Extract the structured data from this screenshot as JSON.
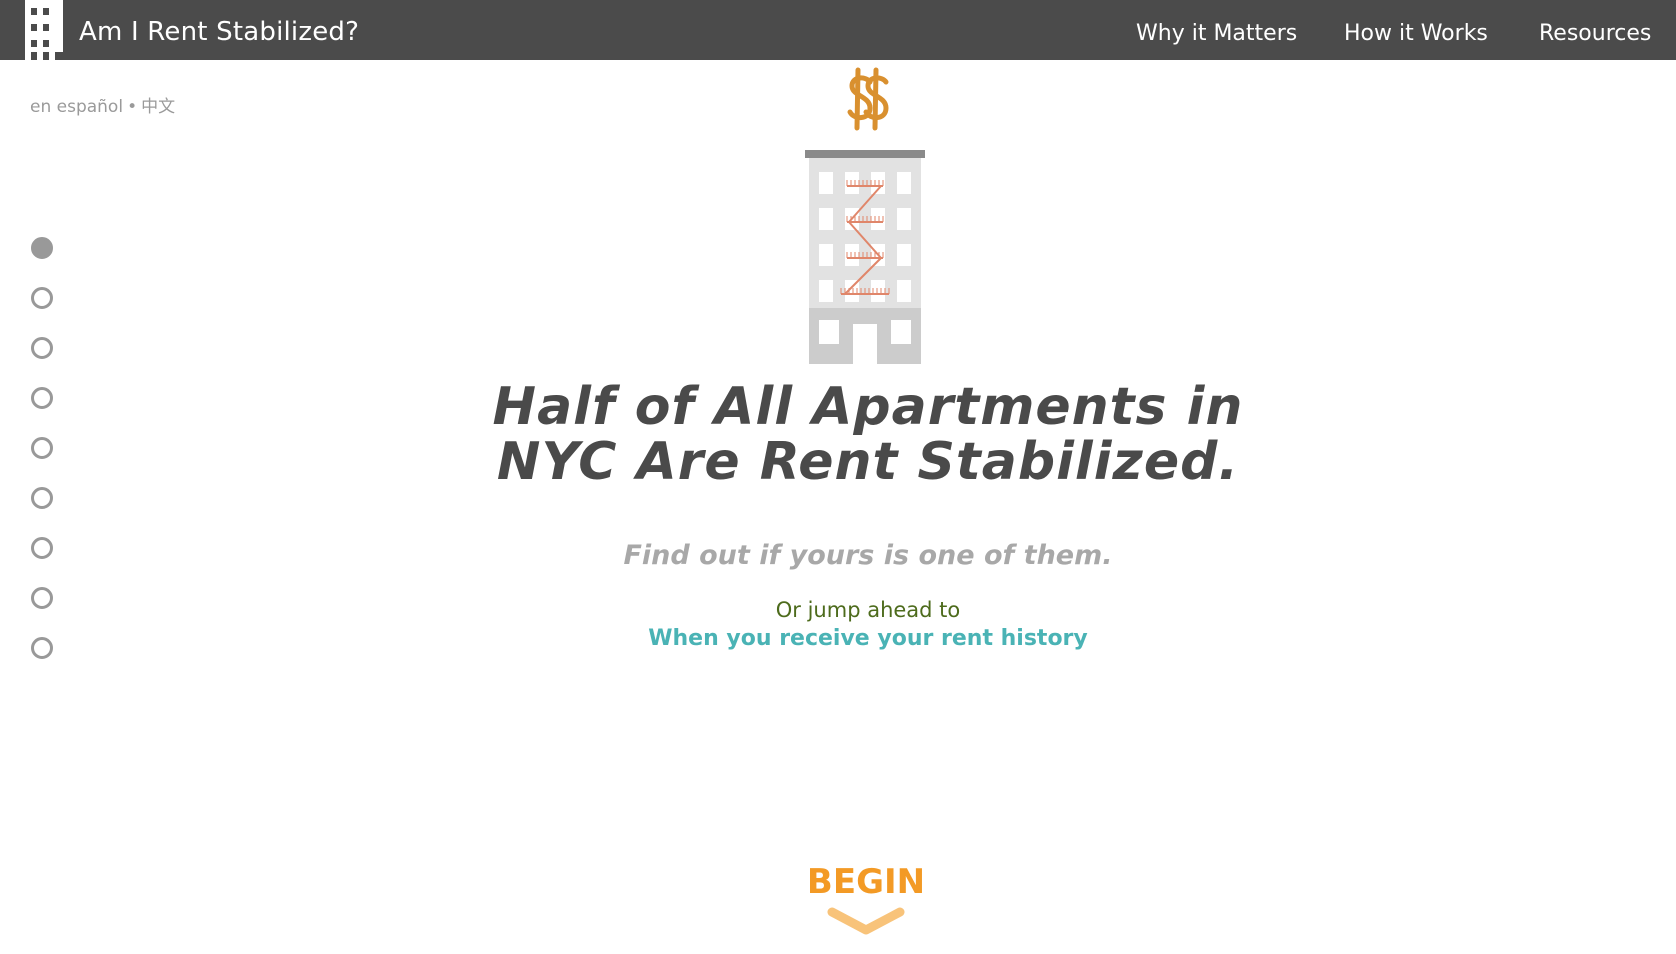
{
  "header": {
    "title": "Am I Rent Stabilized?",
    "logo_icon": "building-logo-icon",
    "nav": [
      {
        "label": "Why it Matters"
      },
      {
        "label": "How it Works"
      },
      {
        "label": "Resources"
      }
    ]
  },
  "languages": {
    "spanish": "en español",
    "separator": "•",
    "chinese": "中文"
  },
  "progress": {
    "total_steps": 9,
    "current_step": 1
  },
  "hero": {
    "illustration": "rent-stabilized-building-icon",
    "money_icon": "dollar-signs-icon",
    "headline_line1": "Half of All Apartments in",
    "headline_line2": "NYC Are Rent Stabilized.",
    "subhead": "Find out if yours is one of them.",
    "jump_text": "Or jump ahead to",
    "jump_link": "When you receive your rent history",
    "begin_label": "BEGIN",
    "begin_icon": "chevron-down-icon"
  },
  "colors": {
    "topbar": "#4b4b4b",
    "accent_orange": "#f39a25",
    "link_teal": "#4ab3b5",
    "jump_green": "#4d6b1c",
    "fire_escape": "#e0866a",
    "dollar_gold": "#d9902f"
  }
}
